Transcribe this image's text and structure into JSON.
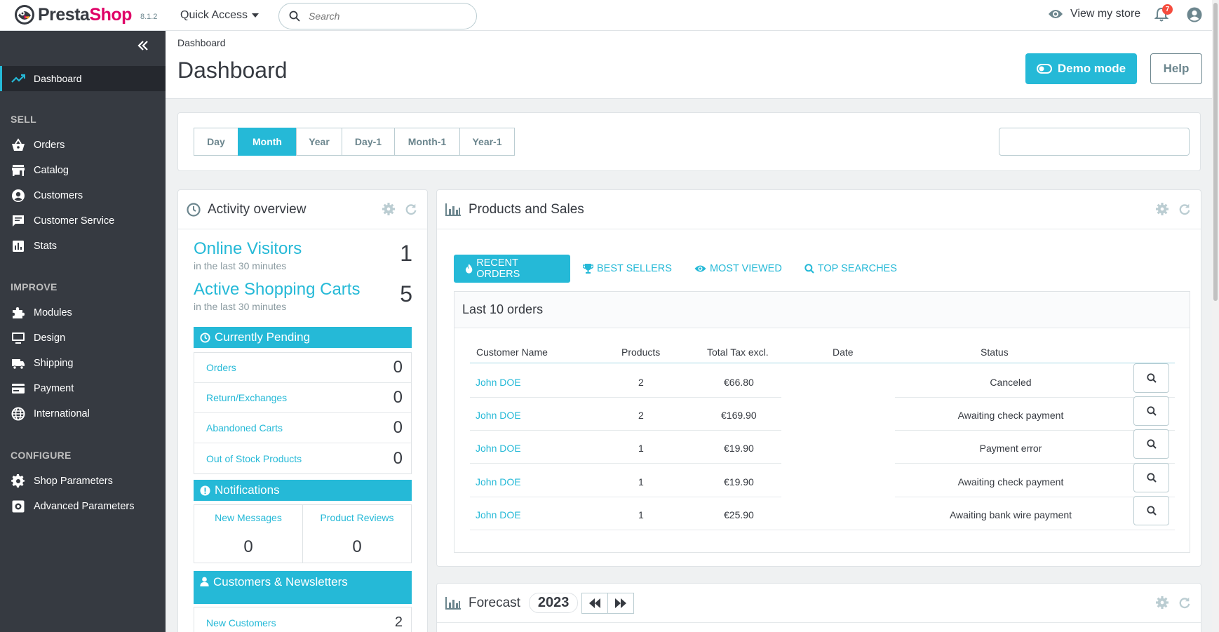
{
  "header": {
    "brand_prefix": "Presta",
    "brand_suffix": "Shop",
    "version": "8.1.2",
    "quick_access": "Quick Access",
    "search_placeholder": "Search",
    "view_store": "View my store",
    "notification_count": "7",
    "colors": {
      "accent": "#25b9d7",
      "brand_pink": "#df0067",
      "sidebar": "#363a41"
    }
  },
  "sidebar": {
    "active": "Dashboard",
    "sections": {
      "sell": "SELL",
      "improve": "IMPROVE",
      "configure": "CONFIGURE"
    },
    "items": [
      {
        "label": "Orders",
        "icon": "basket-icon"
      },
      {
        "label": "Catalog",
        "icon": "store-icon"
      },
      {
        "label": "Customers",
        "icon": "account-circle-icon"
      },
      {
        "label": "Customer Service",
        "icon": "chat-icon"
      },
      {
        "label": "Stats",
        "icon": "chart-icon"
      },
      {
        "label": "Modules",
        "icon": "puzzle-icon"
      },
      {
        "label": "Design",
        "icon": "desktop-icon"
      },
      {
        "label": "Shipping",
        "icon": "truck-icon"
      },
      {
        "label": "Payment",
        "icon": "card-icon"
      },
      {
        "label": "International",
        "icon": "globe-icon"
      },
      {
        "label": "Shop Parameters",
        "icon": "gear-icon"
      },
      {
        "label": "Advanced Parameters",
        "icon": "settings-box-icon"
      }
    ]
  },
  "page": {
    "breadcrumb": "Dashboard",
    "title": "Dashboard",
    "demo_button": "Demo mode",
    "help_button": "Help"
  },
  "range": {
    "buttons": [
      "Day",
      "Month",
      "Year",
      "Day-1",
      "Month-1",
      "Year-1"
    ],
    "active": "Month",
    "date_value": ""
  },
  "activity": {
    "title": "Activity overview",
    "online_visitors": {
      "label": "Online Visitors",
      "sub": "in the last 30 minutes",
      "value": "1"
    },
    "active_carts": {
      "label": "Active Shopping Carts",
      "sub": "in the last 30 minutes",
      "value": "5"
    },
    "pending": {
      "title": "Currently Pending",
      "rows": [
        {
          "label": "Orders",
          "value": "0"
        },
        {
          "label": "Return/Exchanges",
          "value": "0"
        },
        {
          "label": "Abandoned Carts",
          "value": "0"
        },
        {
          "label": "Out of Stock Products",
          "value": "0"
        }
      ]
    },
    "notifications": {
      "title": "Notifications",
      "messages": {
        "label": "New Messages",
        "value": "0"
      },
      "reviews": {
        "label": "Product Reviews",
        "value": "0"
      }
    },
    "customers": {
      "title": "Customers & Newsletters",
      "new_customers": {
        "label": "New Customers",
        "value": "2"
      }
    }
  },
  "products": {
    "title": "Products and Sales",
    "tabs": [
      "Recent Orders",
      "Best Sellers",
      "Most Viewed",
      "Top Searches"
    ],
    "active_tab": "Recent Orders",
    "table_title": "Last 10 orders",
    "columns": [
      "Customer Name",
      "Products",
      "Total Tax excl.",
      "Date",
      "Status"
    ],
    "rows": [
      {
        "customer": "John DOE",
        "products": "2",
        "total": "€66.80",
        "date": "",
        "status": "Canceled"
      },
      {
        "customer": "John DOE",
        "products": "2",
        "total": "€169.90",
        "date": "",
        "status": "Awaiting check payment"
      },
      {
        "customer": "John DOE",
        "products": "1",
        "total": "€19.90",
        "date": "",
        "status": "Payment error"
      },
      {
        "customer": "John DOE",
        "products": "1",
        "total": "€19.90",
        "date": "",
        "status": "Awaiting check payment"
      },
      {
        "customer": "John DOE",
        "products": "1",
        "total": "€25.90",
        "date": "",
        "status": "Awaiting bank wire payment"
      }
    ]
  },
  "forecast": {
    "title": "Forecast",
    "year": "2023"
  }
}
